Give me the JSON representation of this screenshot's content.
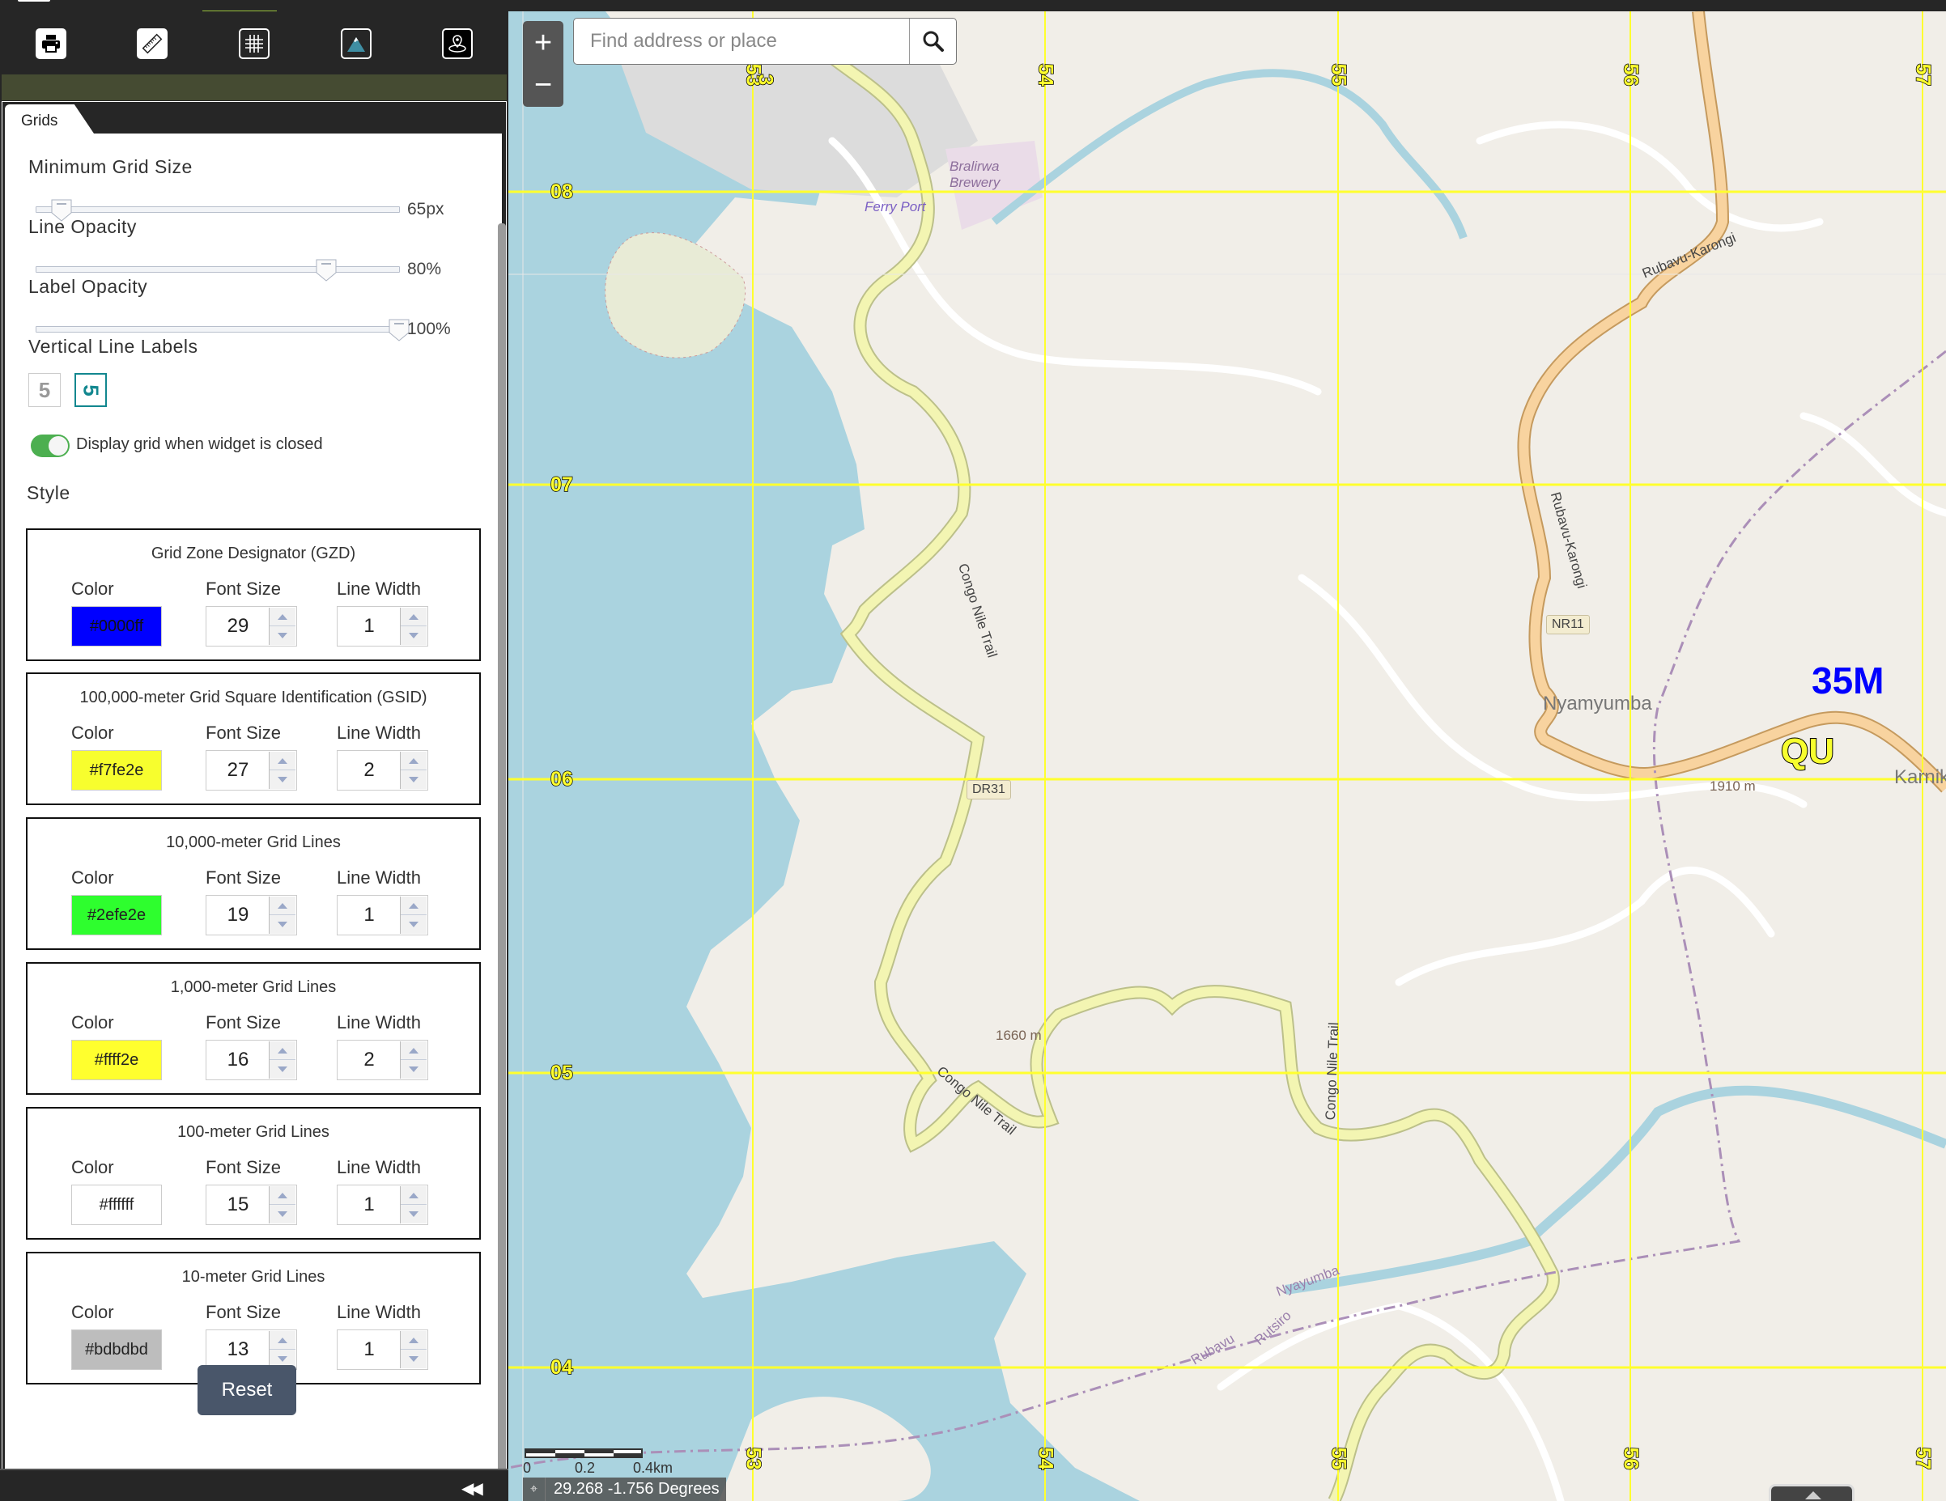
{
  "toolbar": {
    "tools": [
      {
        "name": "print-tool",
        "icon": "printer-icon",
        "label": "Print"
      },
      {
        "name": "measure-tool",
        "icon": "ruler-icon",
        "label": "Measurement"
      },
      {
        "name": "grid-tool",
        "icon": "grid-icon",
        "label": "Grids",
        "active": true
      },
      {
        "name": "elevation-tool",
        "icon": "mountain-icon",
        "label": "Elevation"
      },
      {
        "name": "location-tool",
        "icon": "map-pin-icon",
        "label": "Location"
      }
    ]
  },
  "panel": {
    "tab_label": "Grids",
    "min_grid_size": {
      "label": "Minimum Grid Size",
      "value_text": "65px",
      "fraction": 0.07
    },
    "line_opacity": {
      "label": "Line Opacity",
      "value_text": "80%",
      "fraction": 0.8
    },
    "label_opacity": {
      "label": "Label Opacity",
      "value_text": "100%",
      "fraction": 1.0
    },
    "vertical_line_labels": {
      "label": "Vertical Line Labels",
      "options": [
        "5",
        "5"
      ],
      "selected": 1
    },
    "display_toggle": {
      "label": "Display grid when widget is closed",
      "on": true
    },
    "style_heading": "Style",
    "column_labels": {
      "color": "Color",
      "font_size": "Font Size",
      "line_width": "Line Width"
    },
    "styles": [
      {
        "title": "Grid Zone Designator (GZD)",
        "color": "#0000ff",
        "font_size": "29",
        "line_width": "1"
      },
      {
        "title": "100,000-meter Grid Square Identification (GSID)",
        "color": "#f7fe2e",
        "font_size": "27",
        "line_width": "2"
      },
      {
        "title": "10,000-meter Grid Lines",
        "color": "#2efe2e",
        "font_size": "19",
        "line_width": "1"
      },
      {
        "title": "1,000-meter Grid Lines",
        "color": "#ffff2e",
        "font_size": "16",
        "line_width": "2"
      },
      {
        "title": "100-meter Grid Lines",
        "color": "#ffffff",
        "font_size": "15",
        "line_width": "1"
      },
      {
        "title": "10-meter Grid Lines",
        "color": "#bdbdbd",
        "font_size": "13",
        "line_width": "1"
      }
    ],
    "reset_label": "Reset",
    "collapse_icon": "double-chevron-left-icon"
  },
  "map": {
    "search": {
      "placeholder": "Find address or place",
      "value": ""
    },
    "zoom_in": "+",
    "zoom_out": "−",
    "grid": {
      "easting_labels": [
        "53",
        "54",
        "55",
        "56",
        "57"
      ],
      "northing_labels": [
        "08",
        "07",
        "06",
        "05",
        "04"
      ],
      "gzd_label": "35M",
      "gsid_label": "QU",
      "partial_top_label": "3"
    },
    "features": {
      "places": [
        "Nyamyumba",
        "Karnik"
      ],
      "poi": [
        "Bralirwa Brewery",
        "Ferry Port"
      ],
      "peaks": [
        "1660 m",
        "1910 m"
      ],
      "roads": [
        "Congo Nile Trail",
        "Rubavu-Karongi",
        "DR31",
        "NR11"
      ],
      "boundaries": [
        "Rubavu",
        "Rutsiro",
        "Nyayumba"
      ]
    },
    "scale": {
      "labels": [
        "0",
        "0.2",
        "0.4km"
      ]
    },
    "coordinates": "29.268 -1.756 Degrees"
  }
}
